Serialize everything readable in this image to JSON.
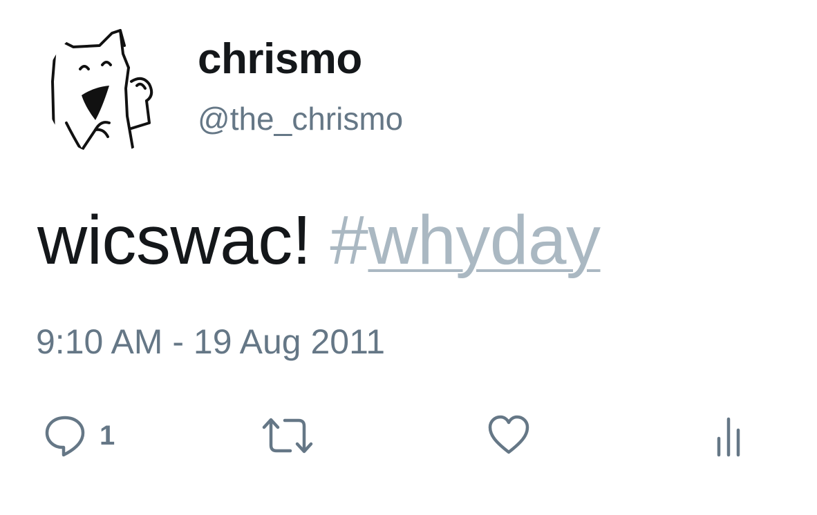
{
  "tweet": {
    "author": {
      "display_name": "chrismo",
      "handle": "@the_chrismo",
      "avatar_icon": "cartoon-cat-avatar"
    },
    "text": {
      "body": "wicswac! ",
      "hashtag_symbol": "#",
      "hashtag_word": "whyday"
    },
    "timestamp": "9:10 AM - 19 Aug 2011",
    "actions": {
      "reply_icon": "speech-bubble-icon",
      "reply_count": "1",
      "retweet_icon": "retweet-icon",
      "like_icon": "heart-icon",
      "analytics_icon": "bar-chart-icon"
    }
  },
  "colors": {
    "text_primary": "#14171a",
    "text_secondary": "#657786",
    "hashtag": "#aab8c2"
  }
}
